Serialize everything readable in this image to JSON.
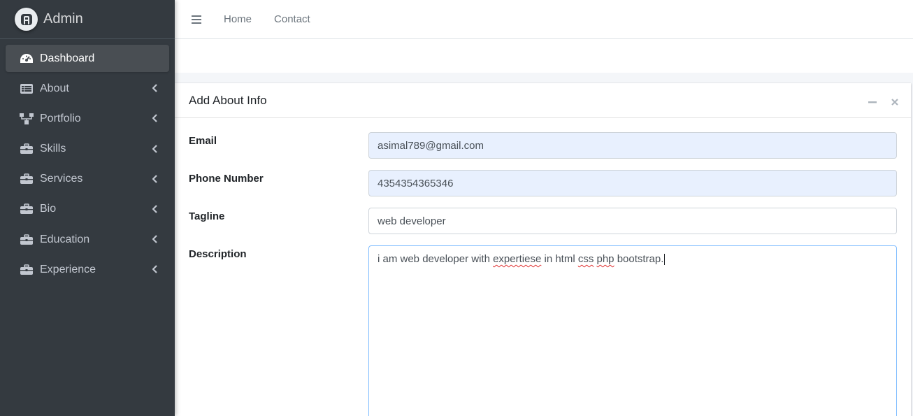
{
  "brand": {
    "name": "Admin",
    "logo_letter": "A"
  },
  "sidebar": {
    "items": [
      {
        "label": "Dashboard",
        "icon": "tachometer-icon",
        "active": true
      },
      {
        "label": "About",
        "icon": "list-alt-icon"
      },
      {
        "label": "Portfolio",
        "icon": "sitemap-icon"
      },
      {
        "label": "Skills",
        "icon": "briefcase-icon"
      },
      {
        "label": "Services",
        "icon": "briefcase-icon"
      },
      {
        "label": "Bio",
        "icon": "briefcase-icon"
      },
      {
        "label": "Education",
        "icon": "briefcase-icon"
      },
      {
        "label": "Experience",
        "icon": "briefcase-icon"
      }
    ]
  },
  "topbar": {
    "home": "Home",
    "contact": "Contact"
  },
  "card": {
    "title": "Add About Info"
  },
  "form": {
    "email": {
      "label": "Email",
      "value": "asimal789@gmail.com"
    },
    "phone": {
      "label": "Phone Number",
      "value": "4354354365346"
    },
    "tagline": {
      "label": "Tagline",
      "value": "web developer"
    },
    "description": {
      "label": "Description",
      "part1": "i am web developer with ",
      "part2": "expertiese",
      "part3": " in html ",
      "part4": "css",
      "part5": " ",
      "part6": "php",
      "part7": " bootstrap."
    }
  },
  "colors": {
    "sidebar_bg": "#343a40",
    "active_bg": "#494e53",
    "autofill_bg": "#e8f0fe",
    "focus_border": "#80bdff"
  }
}
